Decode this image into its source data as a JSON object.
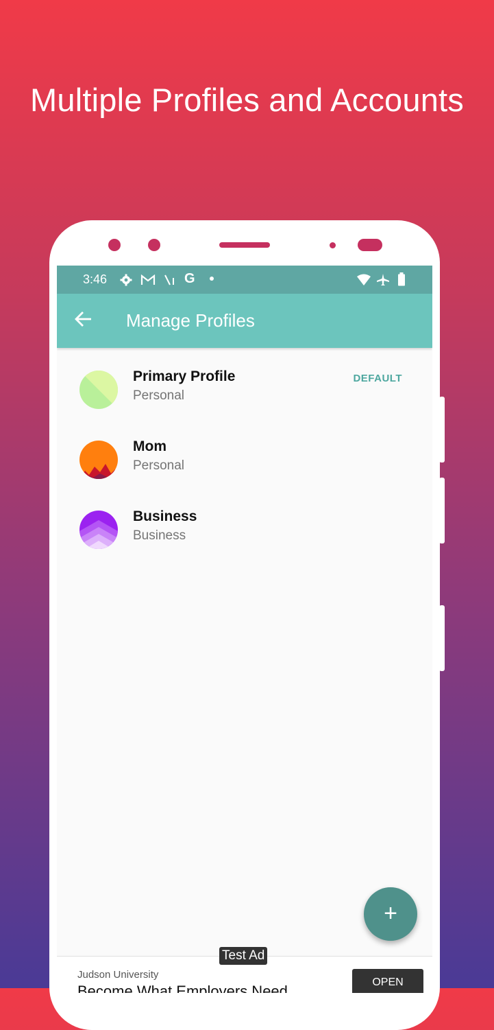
{
  "promo": {
    "headline": "Multiple Profiles and Accounts"
  },
  "status_bar": {
    "time": "3:46",
    "left_icons": [
      "settings-icon",
      "gmail-icon",
      "signal-off-icon",
      "google-icon",
      "dot-icon"
    ],
    "right_icons": [
      "wifi-icon",
      "airplane-icon",
      "battery-icon"
    ]
  },
  "app_bar": {
    "title": "Manage Profiles",
    "back_icon": "arrow-back-icon"
  },
  "profiles": [
    {
      "name": "Primary Profile",
      "type": "Personal",
      "badge": "DEFAULT",
      "avatar": "green-diagonal"
    },
    {
      "name": "Mom",
      "type": "Personal",
      "badge": "",
      "avatar": "orange-mountains"
    },
    {
      "name": "Business",
      "type": "Business",
      "badge": "",
      "avatar": "purple-chevrons"
    }
  ],
  "fab": {
    "label": "+",
    "icon": "add-icon"
  },
  "ad": {
    "tag": "Test Ad",
    "advertiser": "Judson University",
    "headline": "Become What Employers Need",
    "cta": "OPEN"
  },
  "colors": {
    "status_bar": "#5fa7a3",
    "app_bar": "#6cc5bd",
    "accent": "#4da79f",
    "fab": "#4f918b",
    "phone_detail": "#c5305f"
  }
}
